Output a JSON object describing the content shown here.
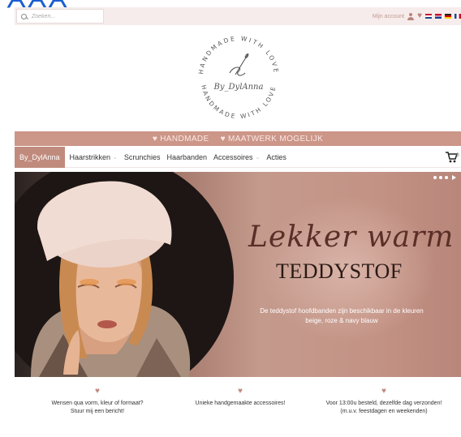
{
  "top_bar": {
    "search_placeholder": "Zoeken...",
    "account_label": "Mijn account"
  },
  "logo": {
    "ring_text_top": "HANDMADE WITH LOVE",
    "ring_text_bottom": "HANDMADE WITH LOVE",
    "signature": "By_DylAnna"
  },
  "promo_bar": {
    "items": [
      "HANDMADE",
      "MAATWERK MOGELIJK"
    ]
  },
  "nav": {
    "brand": "By_DylAnna",
    "items": [
      {
        "label": "Haarstrikken",
        "has_dropdown": true
      },
      {
        "label": "Scrunchies",
        "has_dropdown": false
      },
      {
        "label": "Haarbanden",
        "has_dropdown": false
      },
      {
        "label": "Accessoires",
        "has_dropdown": true
      },
      {
        "label": "Acties",
        "has_dropdown": false
      }
    ],
    "cart_count": "0"
  },
  "hero": {
    "script_title": "Lekker warm",
    "title": "TEDDYSTOF",
    "subtitle_line1": "De teddystof hoofdbanden zijn beschikbaar in de kleuren",
    "subtitle_line2": "beige, roze & navy blauw"
  },
  "usps": [
    {
      "line1": "Wensen qua vorm, kleur of formaat?",
      "line2": "Stuur mij een bericht!"
    },
    {
      "line1": "Unieke handgemaakte accessoires!",
      "line2": ""
    },
    {
      "line1": "Voor 13:00u besteld, dezelfde dag verzonden!",
      "line2": "(m.u.v. feestdagen en weekenden)"
    }
  ],
  "colors": {
    "accent": "#c08b7d",
    "promo": "#cc9688",
    "topbar": "#f6eceb"
  }
}
